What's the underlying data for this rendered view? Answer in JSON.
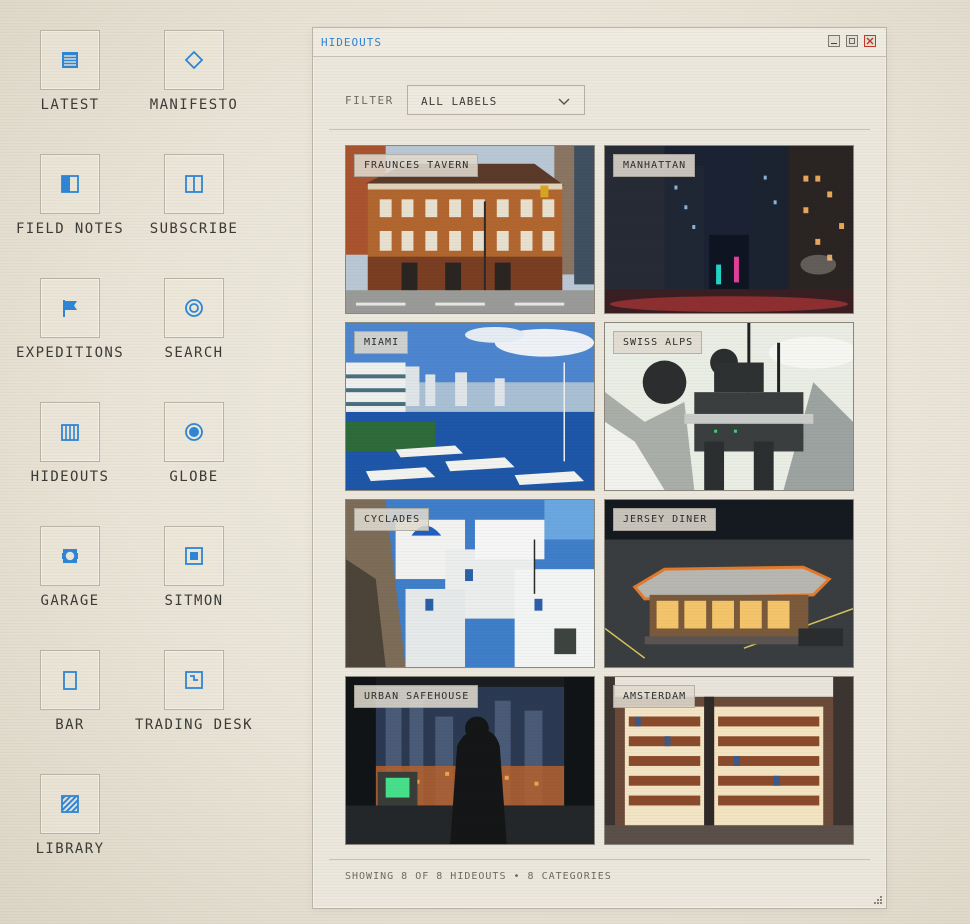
{
  "desktop": {
    "icons": [
      {
        "label": "LATEST",
        "icon": "list-icon"
      },
      {
        "label": "MANIFESTO",
        "icon": "diamond-icon"
      },
      {
        "label": "FIELD NOTES",
        "icon": "notebook-icon"
      },
      {
        "label": "SUBSCRIBE",
        "icon": "columns-icon"
      },
      {
        "label": "EXPEDITIONS",
        "icon": "flag-icon"
      },
      {
        "label": "SEARCH",
        "icon": "target-icon"
      },
      {
        "label": "HIDEOUTS",
        "icon": "building-icon"
      },
      {
        "label": "GLOBE",
        "icon": "globe-dot-icon"
      },
      {
        "label": "GARAGE",
        "icon": "garage-icon"
      },
      {
        "label": "SITMON",
        "icon": "monitor-icon"
      },
      {
        "label": "BAR",
        "icon": "glass-icon"
      },
      {
        "label": "TRADING DESK",
        "icon": "chart-window-icon"
      },
      {
        "label": "LIBRARY",
        "icon": "book-striped-icon"
      }
    ]
  },
  "window": {
    "title": "HIDEOUTS",
    "filter": {
      "label": "FILTER",
      "value": "ALL LABELS"
    },
    "cards": [
      {
        "label": "FRAUNCES TAVERN"
      },
      {
        "label": "MANHATTAN"
      },
      {
        "label": "MIAMI"
      },
      {
        "label": "SWISS ALPS"
      },
      {
        "label": "CYCLADES"
      },
      {
        "label": "JERSEY DINER"
      },
      {
        "label": "URBAN SAFEHOUSE"
      },
      {
        "label": "AMSTERDAM"
      }
    ],
    "status": "SHOWING 8 OF 8 HIDEOUTS • 8 CATEGORIES"
  },
  "colors": {
    "accent": "#2f86d6",
    "close": "#c0392b",
    "background": "#ebe7dc"
  }
}
